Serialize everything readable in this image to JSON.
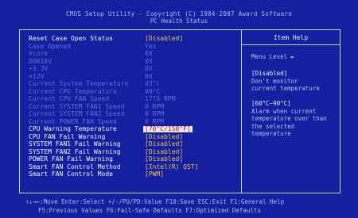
{
  "header": {
    "title": "CMOS Setup Utility - Copyright (C) 1984-2007 Award Software",
    "subtitle": "PC Health Status"
  },
  "settings": [
    {
      "label": "Reset Case Open Status",
      "value": "[Disabled]",
      "state": "editable"
    },
    {
      "label": "Case Opened",
      "value": "Yes",
      "state": "readonly"
    },
    {
      "label": "Vcore",
      "value": "0X",
      "state": "readonly"
    },
    {
      "label": "DDR18V",
      "value": "0X",
      "state": "readonly"
    },
    {
      "label": "+3.3V",
      "value": "0X",
      "state": "readonly"
    },
    {
      "label": "+12V",
      "value": "0X",
      "state": "readonly"
    },
    {
      "label": "Current System Temperature",
      "value": "43°C",
      "state": "readonly"
    },
    {
      "label": "Current CPU Temperature",
      "value": "49°C",
      "state": "readonly"
    },
    {
      "label": "Current CPU FAN Speed",
      "value": "1776 RPM",
      "state": "readonly"
    },
    {
      "label": "Current SYSTEM FAN1 Speed",
      "value": "0 RPM",
      "state": "readonly"
    },
    {
      "label": "Current SYSTEM FAN2 Speed",
      "value": "0 RPM",
      "state": "readonly"
    },
    {
      "label": "Current POWER FAN Speed",
      "value": "0 RPM",
      "state": "readonly"
    },
    {
      "label": "CPU Warning Temperature",
      "value": "[70°C/158°F]",
      "state": "selected"
    },
    {
      "label": "CPU FAN Fail Warning",
      "value": "[Disabled]",
      "state": "editable"
    },
    {
      "label": "SYSTEM FAN1 Fail Warning",
      "value": "[Disabled]",
      "state": "editable"
    },
    {
      "label": "SYSTEM FAN2 Fail Warning",
      "value": "[Disabled]",
      "state": "editable"
    },
    {
      "label": "POWER FAN Fail Warning",
      "value": "[Disabled]",
      "state": "editable"
    },
    {
      "label": "Smart FAN Control Method",
      "value": "[Intel(R) QST]",
      "state": "editable"
    },
    {
      "label": "Smart FAN Control Mode",
      "value": "[PWM]",
      "state": "editable"
    }
  ],
  "help": {
    "title": "Item Help",
    "menu_level": "Menu Level  ►",
    "lines": [
      {
        "text": "[Disabled]",
        "bright": true
      },
      {
        "text": "Don't monitor",
        "bright": false
      },
      {
        "text": "current temperature",
        "bright": false
      },
      {
        "text": "",
        "bright": false
      },
      {
        "text": "[60°C~90°C]",
        "bright": true
      },
      {
        "text": "Alarm when current",
        "bright": false
      },
      {
        "text": "temperature over than",
        "bright": false
      },
      {
        "text": "the selected",
        "bright": false
      },
      {
        "text": "temperature",
        "bright": false
      }
    ]
  },
  "footer": {
    "line1": "↑↓→←:Move  Enter:Select  +/-/PU/PD:Value  F10:Save  ESC:Exit  F1:General Help",
    "line2": "F5:Previous Values  F6:Fail-Safe Defaults  F7:Optimized Defaults"
  },
  "colors": {
    "background": "#1420a0",
    "active_label": "#f2f2f2",
    "readonly_label": "#5a72d8",
    "value": "#e8c14a",
    "selected_bg": "#e8e8e8",
    "selected_fg": "#c01818"
  }
}
